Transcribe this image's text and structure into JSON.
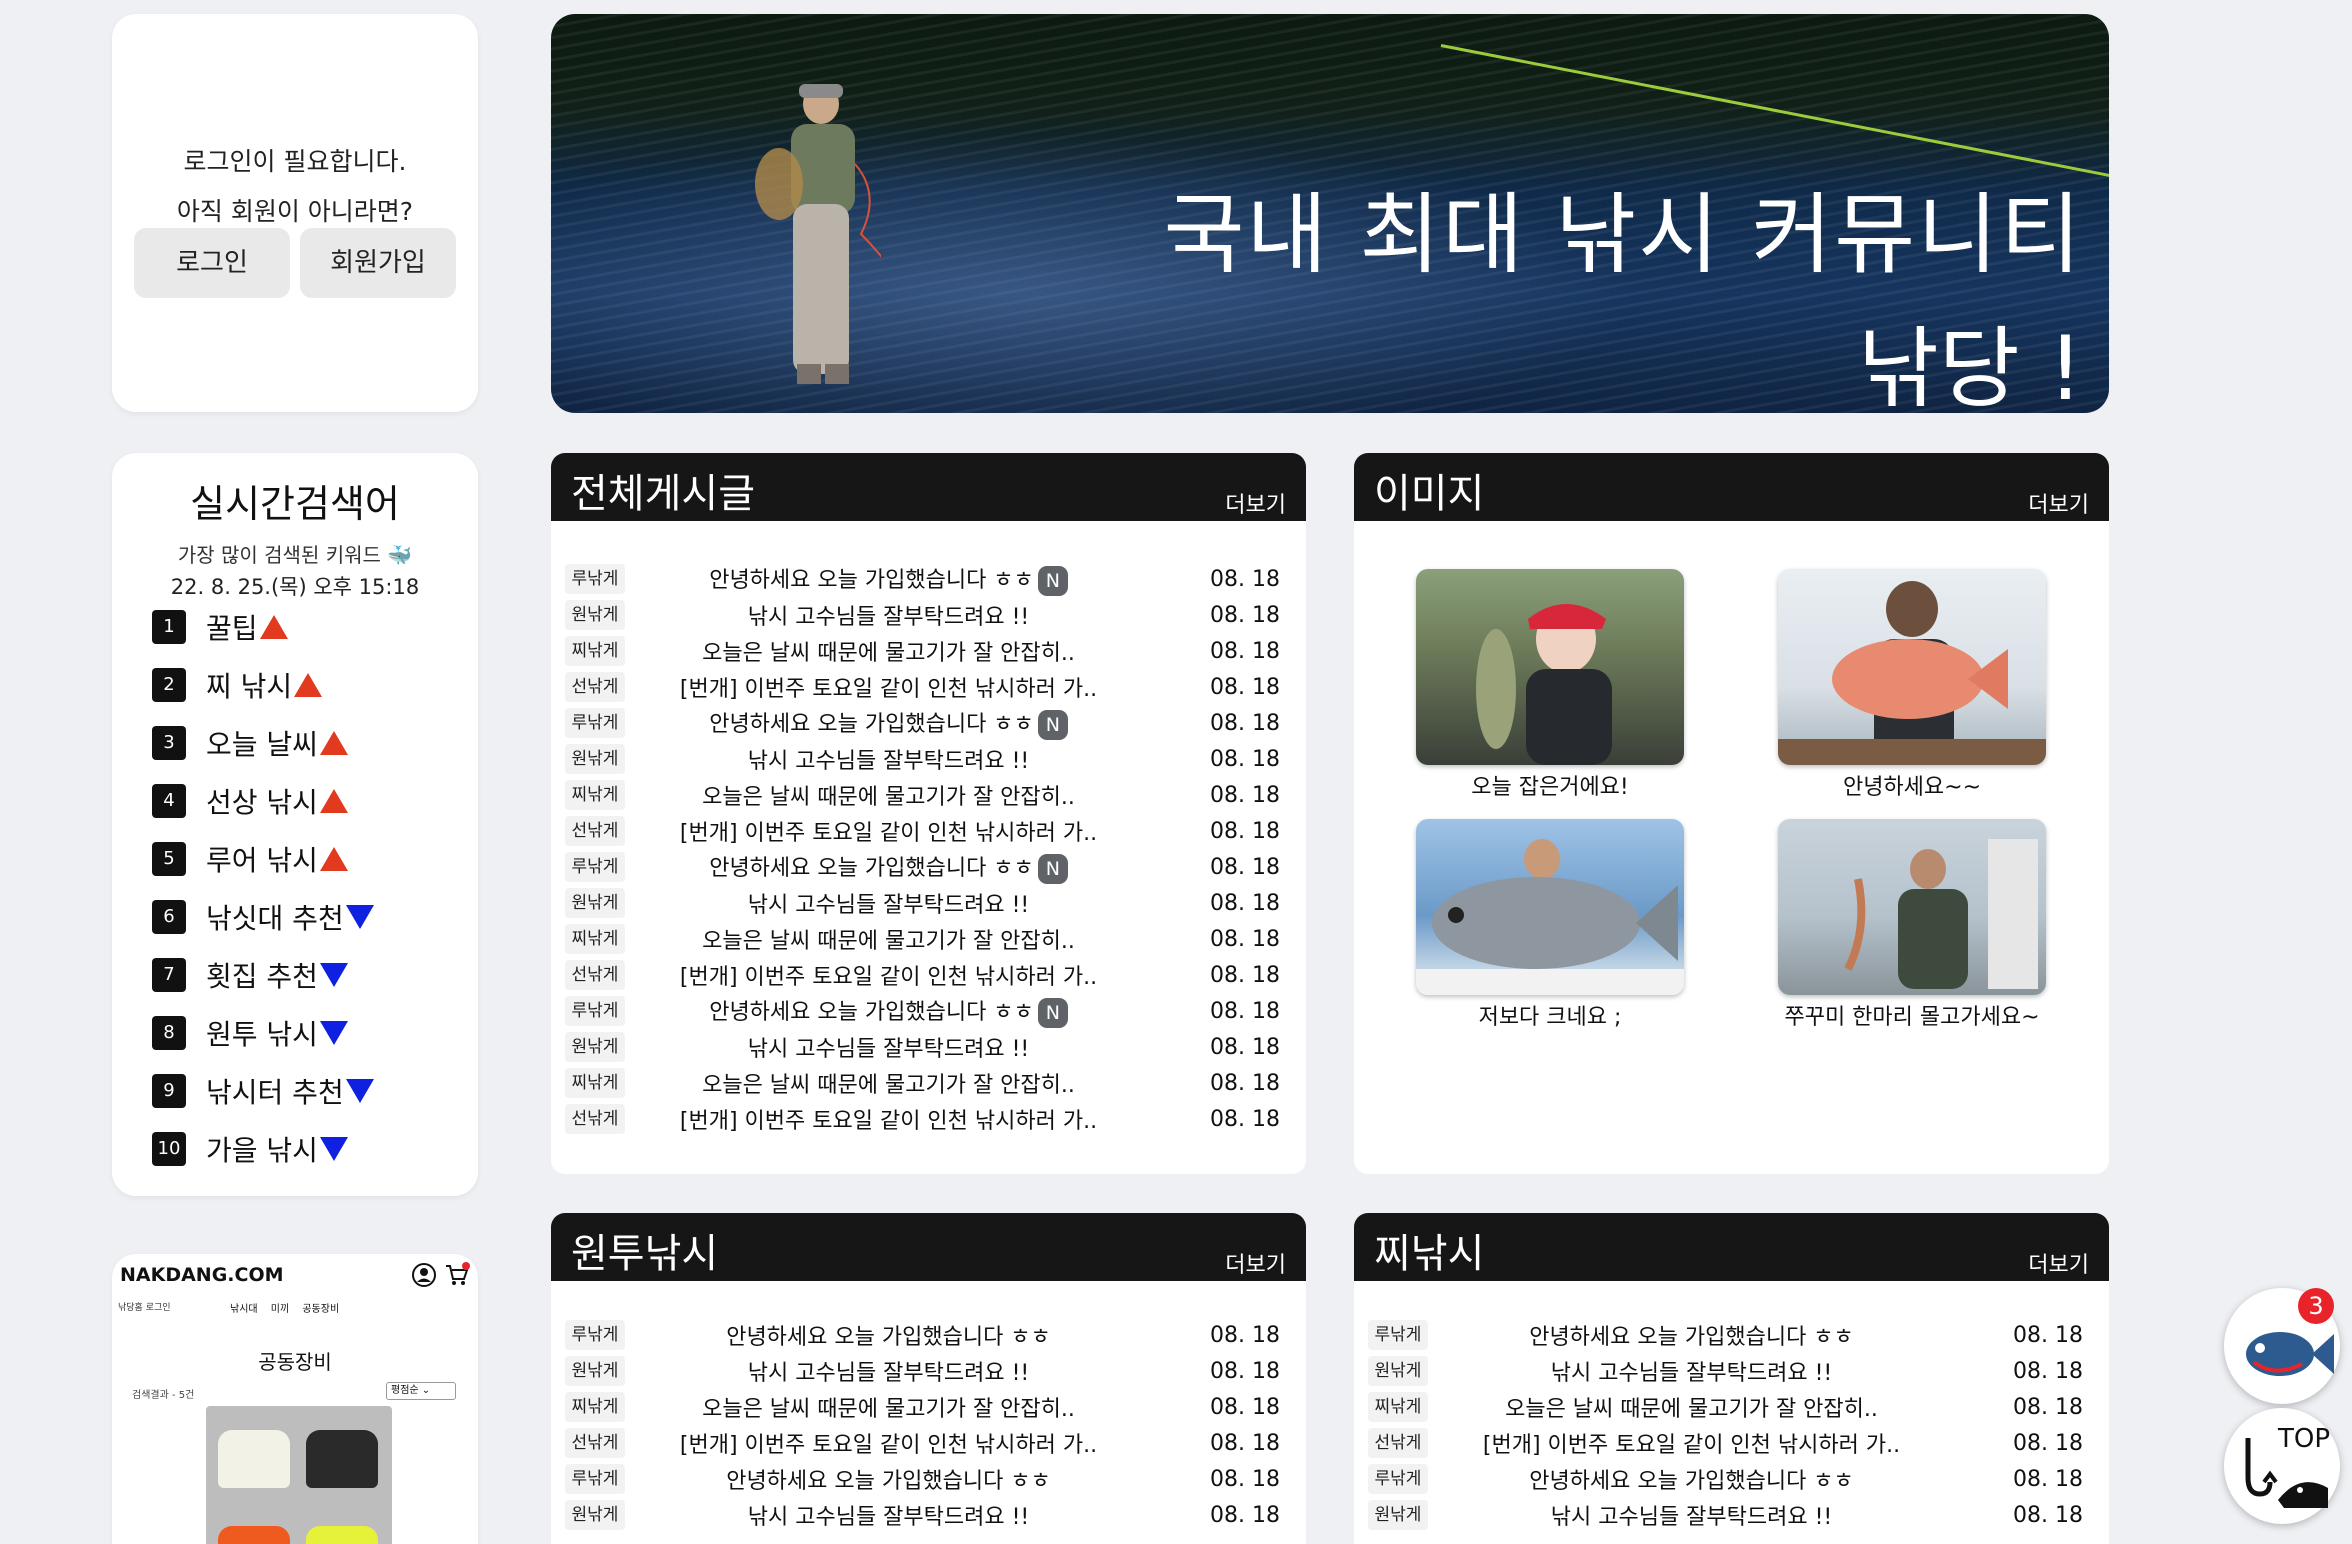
{
  "login": {
    "message": "로그인이 필요합니다.",
    "prompt": "아직 회원이 아니라면?",
    "login_label": "로그인",
    "signup_label": "회원가입"
  },
  "banner": {
    "line1": "국내 최대 낚시 커뮤니티",
    "line2": "낚당 !"
  },
  "ranking": {
    "title": "실시간검색어",
    "subtitle": "가장 많이 검색된 키워드 🐳",
    "date": "22. 8. 25.(목) 오후 15:18",
    "items": [
      {
        "rank": "1",
        "keyword": "꿀팁",
        "trend": "up"
      },
      {
        "rank": "2",
        "keyword": "찌 낚시",
        "trend": "up"
      },
      {
        "rank": "3",
        "keyword": "오늘 날씨",
        "trend": "up"
      },
      {
        "rank": "4",
        "keyword": "선상 낚시",
        "trend": "up"
      },
      {
        "rank": "5",
        "keyword": "루어 낚시",
        "trend": "up"
      },
      {
        "rank": "6",
        "keyword": "낚싯대 추천",
        "trend": "down"
      },
      {
        "rank": "7",
        "keyword": "횟집 추천",
        "trend": "down"
      },
      {
        "rank": "8",
        "keyword": "원투 낚시",
        "trend": "down"
      },
      {
        "rank": "9",
        "keyword": "낚시터 추천",
        "trend": "down"
      },
      {
        "rank": "10",
        "keyword": "가을 낚시",
        "trend": "down"
      }
    ]
  },
  "mini_preview": {
    "brand": "NAKDANG.COM",
    "nav": "낚당홈   로그인",
    "nav_cats": "낚시대 미끼 공동장비",
    "page_title": "공동장비",
    "result": "검색결과 - 5건",
    "sort": "평점순"
  },
  "boards": {
    "all": {
      "title": "전체게시글",
      "more": "더보기",
      "posts": [
        {
          "cat": "루낚게",
          "title": "안녕하세요 오늘 가입했습니다 ㅎㅎ",
          "new": "N",
          "date": "08. 18"
        },
        {
          "cat": "원낚게",
          "title": "낚시 고수님들 잘부탁드려요 !!",
          "new": "",
          "date": "08. 18"
        },
        {
          "cat": "찌낚게",
          "title": "오늘은 날씨 때문에 물고기가 잘 안잡히..",
          "new": "",
          "date": "08. 18"
        },
        {
          "cat": "선낚게",
          "title": "[번개] 이번주 토요일 같이 인천 낚시하러 가..",
          "new": "",
          "date": "08. 18"
        },
        {
          "cat": "루낚게",
          "title": "안녕하세요 오늘 가입했습니다 ㅎㅎ",
          "new": "N",
          "date": "08. 18"
        },
        {
          "cat": "원낚게",
          "title": "낚시 고수님들 잘부탁드려요 !!",
          "new": "",
          "date": "08. 18"
        },
        {
          "cat": "찌낚게",
          "title": "오늘은 날씨 때문에 물고기가 잘 안잡히..",
          "new": "",
          "date": "08. 18"
        },
        {
          "cat": "선낚게",
          "title": "[번개] 이번주 토요일 같이 인천 낚시하러 가..",
          "new": "",
          "date": "08. 18"
        },
        {
          "cat": "루낚게",
          "title": "안녕하세요 오늘 가입했습니다 ㅎㅎ",
          "new": "N",
          "date": "08. 18"
        },
        {
          "cat": "원낚게",
          "title": "낚시 고수님들 잘부탁드려요 !!",
          "new": "",
          "date": "08. 18"
        },
        {
          "cat": "찌낚게",
          "title": "오늘은 날씨 때문에 물고기가 잘 안잡히..",
          "new": "",
          "date": "08. 18"
        },
        {
          "cat": "선낚게",
          "title": "[번개] 이번주 토요일 같이 인천 낚시하러 가..",
          "new": "",
          "date": "08. 18"
        },
        {
          "cat": "루낚게",
          "title": "안녕하세요 오늘 가입했습니다 ㅎㅎ",
          "new": "N",
          "date": "08. 18"
        },
        {
          "cat": "원낚게",
          "title": "낚시 고수님들 잘부탁드려요 !!",
          "new": "",
          "date": "08. 18"
        },
        {
          "cat": "찌낚게",
          "title": "오늘은 날씨 때문에 물고기가 잘 안잡히..",
          "new": "",
          "date": "08. 18"
        },
        {
          "cat": "선낚게",
          "title": "[번개] 이번주 토요일 같이 인천 낚시하러 가..",
          "new": "",
          "date": "08. 18"
        }
      ]
    },
    "images": {
      "title": "이미지",
      "more": "더보기",
      "items": [
        {
          "caption": "오늘 잡은거에요!"
        },
        {
          "caption": "안녕하세요~~"
        },
        {
          "caption": "저보다 크네요 ;"
        },
        {
          "caption": "쭈꾸미 한마리 몰고가세요~"
        }
      ]
    },
    "wontu": {
      "title": "원투낚시",
      "more": "더보기",
      "posts": [
        {
          "cat": "루낚게",
          "title": "안녕하세요 오늘 가입했습니다 ㅎㅎ",
          "date": "08. 18"
        },
        {
          "cat": "원낚게",
          "title": "낚시 고수님들 잘부탁드려요 !!",
          "date": "08. 18"
        },
        {
          "cat": "찌낚게",
          "title": "오늘은 날씨 때문에 물고기가 잘 안잡히..",
          "date": "08. 18"
        },
        {
          "cat": "선낚게",
          "title": "[번개] 이번주 토요일 같이 인천 낚시하러 가..",
          "date": "08. 18"
        },
        {
          "cat": "루낚게",
          "title": "안녕하세요 오늘 가입했습니다 ㅎㅎ",
          "date": "08. 18"
        },
        {
          "cat": "원낚게",
          "title": "낚시 고수님들 잘부탁드려요 !!",
          "date": "08. 18"
        }
      ]
    },
    "jji": {
      "title": "찌낚시",
      "more": "더보기",
      "posts": [
        {
          "cat": "루낚게",
          "title": "안녕하세요 오늘 가입했습니다 ㅎㅎ",
          "date": "08. 18"
        },
        {
          "cat": "원낚게",
          "title": "낚시 고수님들 잘부탁드려요 !!",
          "date": "08. 18"
        },
        {
          "cat": "찌낚게",
          "title": "오늘은 날씨 때문에 물고기가 잘 안잡히..",
          "date": "08. 18"
        },
        {
          "cat": "선낚게",
          "title": "[번개] 이번주 토요일 같이 인천 낚시하러 가..",
          "date": "08. 18"
        },
        {
          "cat": "루낚게",
          "title": "안녕하세요 오늘 가입했습니다 ㅎㅎ",
          "date": "08. 18"
        },
        {
          "cat": "원낚게",
          "title": "낚시 고수님들 잘부탁드려요 !!",
          "date": "08. 18"
        }
      ]
    }
  },
  "floating": {
    "cart_count": "3",
    "top_label": "TOP"
  },
  "colors": {
    "trend_up": "#e23a1f",
    "trend_down": "#1020e0",
    "board_header": "#161616",
    "badge_new": "#5f6368",
    "cart_badge": "#e8232a"
  }
}
